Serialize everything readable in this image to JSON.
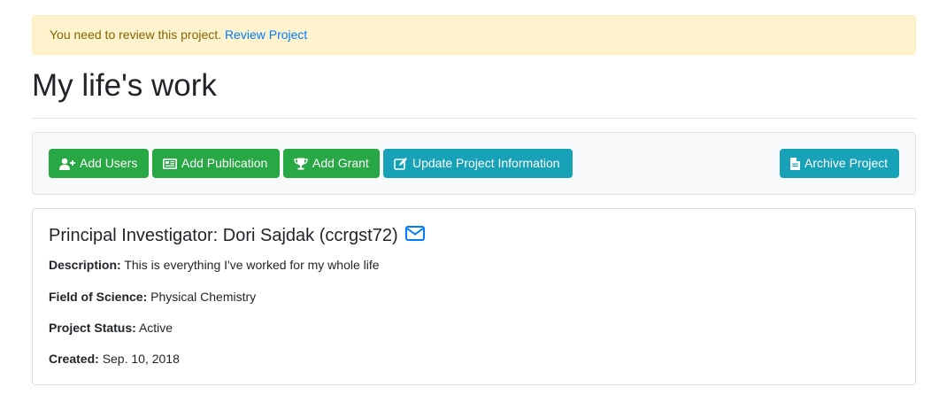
{
  "alert": {
    "message": "You need to review this project.",
    "link_label": "Review Project"
  },
  "page": {
    "title": "My life's work"
  },
  "toolbar": {
    "add_users_label": "Add Users",
    "add_publication_label": "Add Publication",
    "add_grant_label": "Add Grant",
    "update_project_label": "Update Project Information",
    "archive_project_label": "Archive Project"
  },
  "project": {
    "pi_heading": "Principal Investigator: Dori Sajdak (ccrgst72)",
    "description_label": "Description:",
    "description": "This is everything I've worked for my whole life",
    "field_of_science_label": "Field of Science:",
    "field_of_science": "Physical Chemistry",
    "status_label": "Project Status:",
    "status": "Active",
    "created_label": "Created:",
    "created": "Sep. 10, 2018"
  },
  "icons": {
    "add_users": "user-plus-icon",
    "add_publication": "newspaper-icon",
    "add_grant": "trophy-icon",
    "update_project": "edit-icon",
    "archive_project": "file-icon",
    "email": "envelope-icon"
  },
  "colors": {
    "success": "#28a745",
    "info": "#17a2b8",
    "link": "#007bff",
    "alert_bg": "#fff3cd",
    "alert_text": "#856404"
  }
}
